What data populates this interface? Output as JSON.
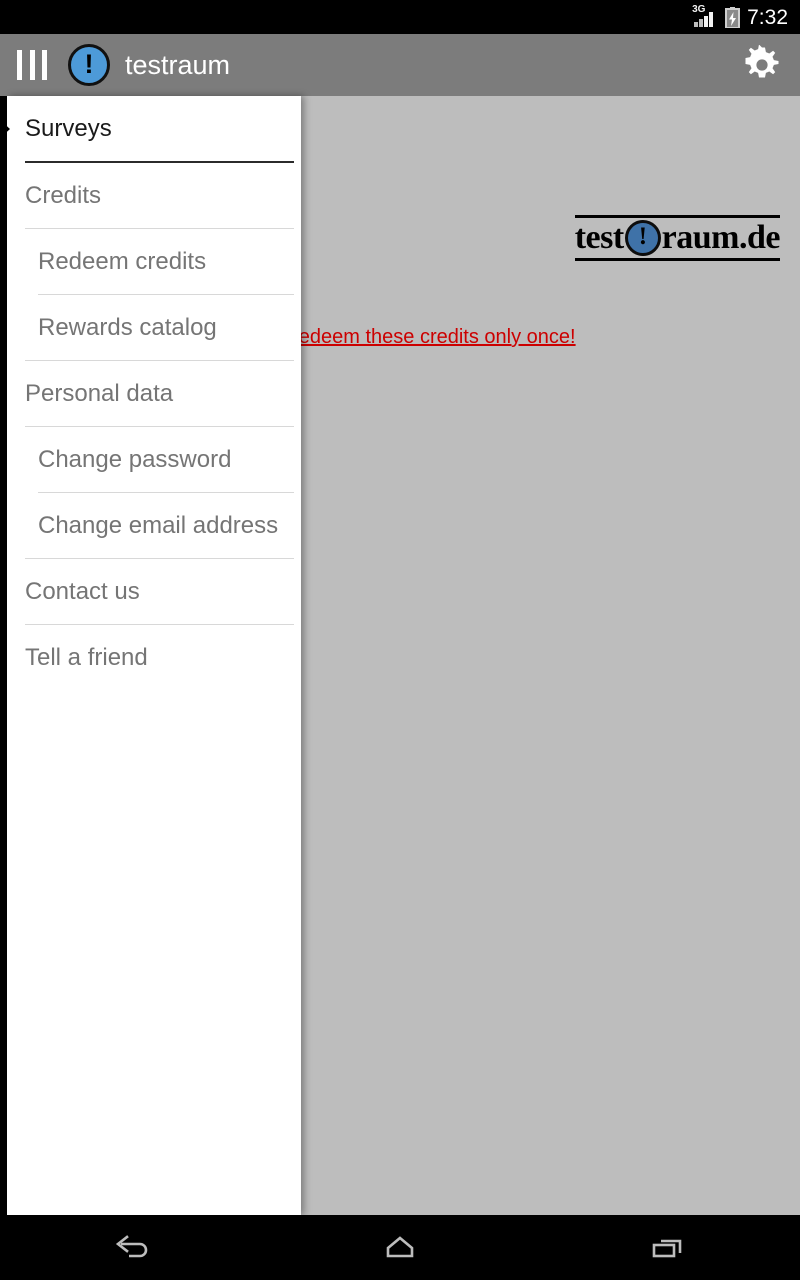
{
  "status_bar": {
    "network_label": "3G",
    "signal_icon": "signal-bars-icon",
    "battery_icon": "battery-charging-icon",
    "clock": "7:32",
    "background": "#000000"
  },
  "app_bar": {
    "background": "#7c7c7c",
    "drawer_toggle_icon": "drawer-toggle-icon",
    "logo_icon": "testraum-logo-icon",
    "logo_glyph": "!",
    "title": "testraum",
    "settings_icon": "gear-icon",
    "title_color": "#ffffff"
  },
  "drawer": {
    "background": "#ffffff",
    "items": [
      {
        "label": "Surveys",
        "level": 0,
        "selected": true
      },
      {
        "label": "Credits",
        "level": 0,
        "selected": false
      },
      {
        "label": "Redeem credits",
        "level": 1,
        "selected": false
      },
      {
        "label": "Rewards catalog",
        "level": 1,
        "selected": false
      },
      {
        "label": "Personal data",
        "level": 0,
        "selected": false
      },
      {
        "label": "Change password",
        "level": 1,
        "selected": false
      },
      {
        "label": "Change email address",
        "level": 1,
        "selected": false
      },
      {
        "label": "Contact us",
        "level": 0,
        "selected": false
      },
      {
        "label": "Tell a friend",
        "level": 0,
        "selected": false
      }
    ]
  },
  "content": {
    "scrim_color": "#bdbdbd",
    "site_logo": {
      "text_before": "test",
      "mark_glyph": "!",
      "text_after": "raum.de",
      "mark_color": "#3f72a8"
    },
    "promo_link": {
      "text": "You can redeem these credits only once!",
      "color": "#cc0000"
    }
  },
  "nav_bar": {
    "background": "#000000",
    "buttons": [
      {
        "icon": "back-icon"
      },
      {
        "icon": "home-icon"
      },
      {
        "icon": "recents-icon"
      }
    ]
  }
}
